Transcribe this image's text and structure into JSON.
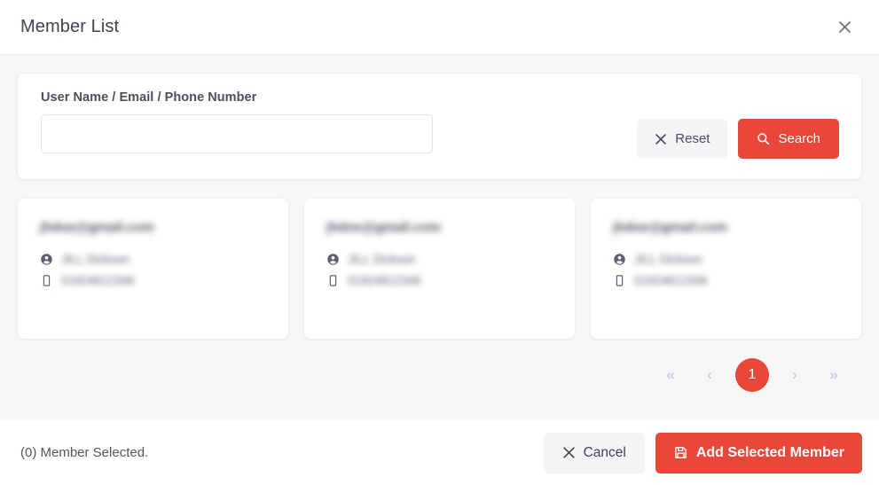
{
  "header": {
    "title": "Member List",
    "close_icon": "close-icon"
  },
  "search": {
    "label": "User Name / Email / Phone Number",
    "input_value": "",
    "input_placeholder": "",
    "reset_label": "Reset",
    "reset_icon": "close-icon",
    "search_label": "Search",
    "search_icon": "search-icon"
  },
  "members": [
    {
      "email": "jhdoe@gmail.com",
      "name": "JILL Dickson",
      "phone": "01924812346",
      "name_icon": "account-circle-icon",
      "phone_icon": "mobile-phone-icon"
    },
    {
      "email": "jhdoe@gmail.com",
      "name": "JILL Dickson",
      "phone": "01924812346",
      "name_icon": "account-circle-icon",
      "phone_icon": "mobile-phone-icon"
    },
    {
      "email": "jhdoe@gmail.com",
      "name": "JILL Dickson",
      "phone": "01924812346",
      "name_icon": "account-circle-icon",
      "phone_icon": "mobile-phone-icon"
    }
  ],
  "pagination": {
    "first_label": "«",
    "prev_label": "‹",
    "current_page": "1",
    "next_label": "›",
    "last_label": "»"
  },
  "footer": {
    "selected_text": "(0) Member Selected.",
    "cancel_label": "Cancel",
    "cancel_icon": "close-icon",
    "submit_label": "Add Selected Member",
    "submit_icon": "save-icon"
  },
  "colors": {
    "accent": "#e8473a",
    "page_background": "#f6f7f8",
    "surface": "#ffffff",
    "text": "#4a4f58",
    "muted": "#bfc4cc",
    "border": "#dfe3e8"
  }
}
